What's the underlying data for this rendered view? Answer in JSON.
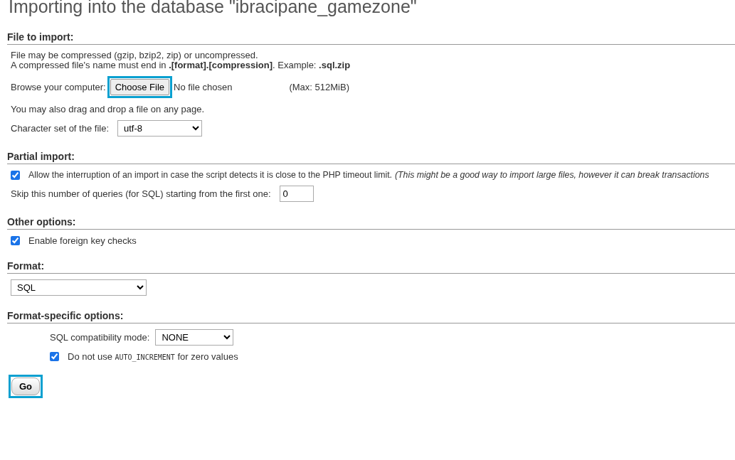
{
  "title": "Importing into the database \"ibracipane_gamezone\"",
  "file_section": {
    "heading": "File to import:",
    "notes": [
      "File may be compressed (gzip, bzip2, zip) or uncompressed.",
      "A compressed file's name must end in **.[format].[compression]**. Example: **.sql.zip**"
    ],
    "browse_label": "Browse your computer:",
    "choose_button": {
      "label": "Choose File",
      "highlighted": true
    },
    "file_status": "No file chosen",
    "max_size": "(Max: 512MiB)",
    "drag_note": "You may also drag and drop a file on any page.",
    "charset_label": "Character set of the file:",
    "charset_value": "utf-8"
  },
  "partial_section": {
    "heading": "Partial import:",
    "interrupt": {
      "checked": true,
      "label": "Allow the interruption of an import in case the script detects it is close to the PHP timeout limit.",
      "note": "(This might be a good way to import large files, however it can break transactions"
    },
    "skip_label": "Skip this number of queries (for SQL) starting from the first one:",
    "skip_value": "0"
  },
  "other_section": {
    "heading": "Other options:",
    "foreign_key": {
      "checked": true,
      "label": "Enable foreign key checks"
    }
  },
  "format_section": {
    "heading": "Format:",
    "format_value": "SQL"
  },
  "specific_section": {
    "heading": "Format-specific options:",
    "compat_label": "SQL compatibility mode:",
    "compat_value": "NONE",
    "auto_increment": {
      "checked": true,
      "label_before": "Do not use",
      "code": "AUTO_INCREMENT",
      "label_after": "for zero values"
    }
  },
  "go_button": {
    "label": "Go",
    "highlighted": true
  }
}
